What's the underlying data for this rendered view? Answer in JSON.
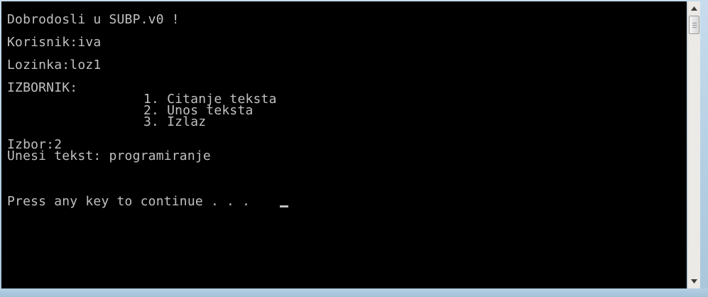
{
  "console": {
    "lines": {
      "welcome": "Dobrodosli u SUBP.v0 !",
      "user": "Korisnik:iva",
      "password": "Lozinka:loz1",
      "menu_title": "IZBORNIK:",
      "menu_item_1": "1. Citanje teksta",
      "menu_item_2": "2. Unos teksta",
      "menu_item_3": "3. Izlaz",
      "choice": "Izbor:2",
      "input_text": "Unesi tekst: programiranje",
      "press_any_key": "Press any key to continue . . ."
    },
    "colors": {
      "background": "#000000",
      "text": "#c0c0c0"
    }
  },
  "scrollbar": {
    "up_icon": "triangle-up",
    "down_icon": "triangle-down"
  }
}
